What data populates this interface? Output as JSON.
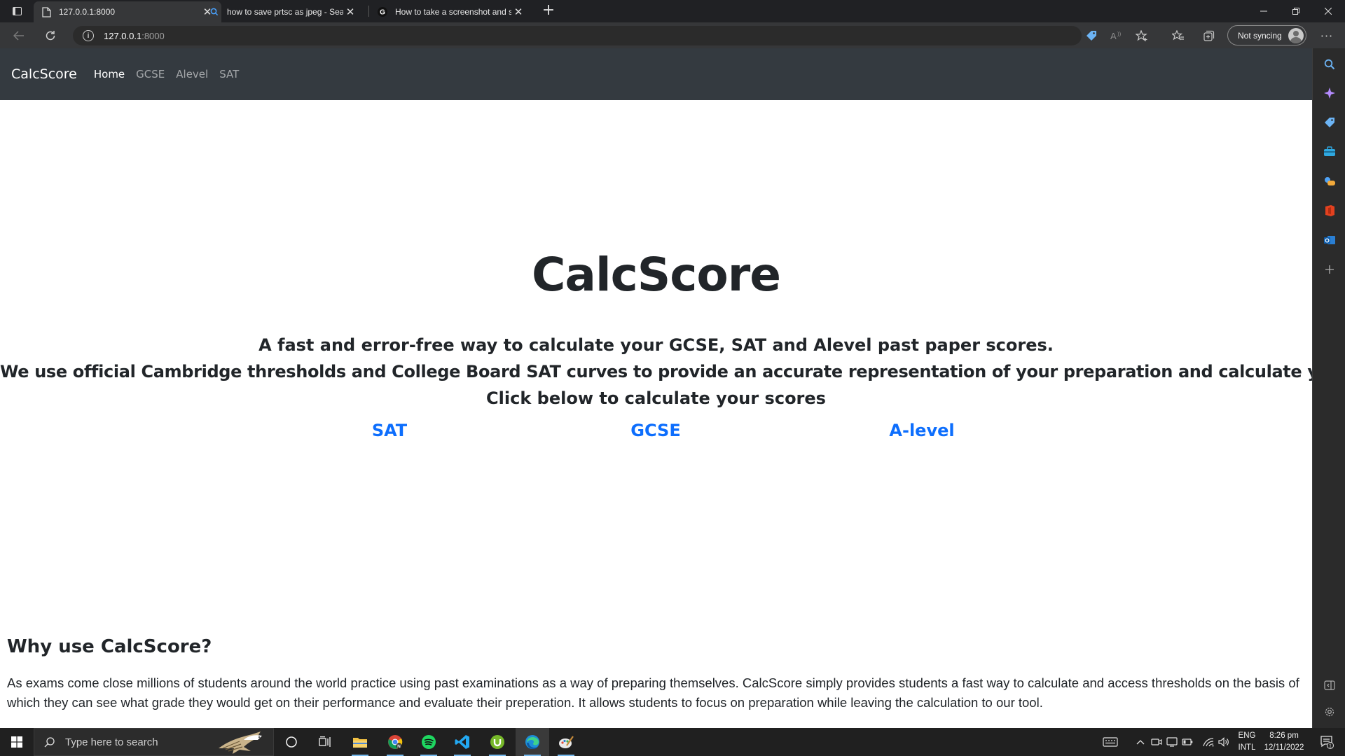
{
  "browser": {
    "tabs": [
      {
        "title": "127.0.0.1:8000",
        "icon": "page-icon"
      },
      {
        "title": "how to save prtsc as jpeg - Search",
        "icon": "search-icon"
      },
      {
        "title": "How to take a screenshot and save",
        "icon": "google-icon"
      }
    ],
    "address": {
      "host": "127.0.0.1",
      "port": ":8000"
    },
    "sync_label": "Not syncing"
  },
  "site": {
    "brand": "CalcScore",
    "nav": [
      "Home",
      "GCSE",
      "Alevel",
      "SAT"
    ],
    "hero_title": "CalcScore",
    "lead_lines": [
      "A fast and error-free way to calculate your GCSE, SAT and Alevel past paper scores.",
      "We use official Cambridge thresholds and College Board SAT curves to provide an accurate representation of your preparation and calculate your grade.",
      "Click below to calculate your scores"
    ],
    "links": [
      "SAT",
      "GCSE",
      "A-level"
    ],
    "why_heading": "Why use CalcScore?",
    "why_text": "As exams come close millions of students around the world practice using past examinations as a way of preparing themselves. CalcScore simply provides students a fast way to calculate and access thresholds on the basis of which they can see what grade they would get on their performance and evaluate their preperation. It allows students to focus on preparation while leaving the calculation to our tool.",
    "colors": {
      "navbar": "#343a40",
      "link": "#0d6efd",
      "text": "#212529"
    }
  },
  "taskbar": {
    "search_placeholder": "Type here to search",
    "lang_top": "ENG",
    "lang_bottom": "INTL",
    "time": "8:26 pm",
    "date": "12/11/2022",
    "notification_count": "1"
  }
}
